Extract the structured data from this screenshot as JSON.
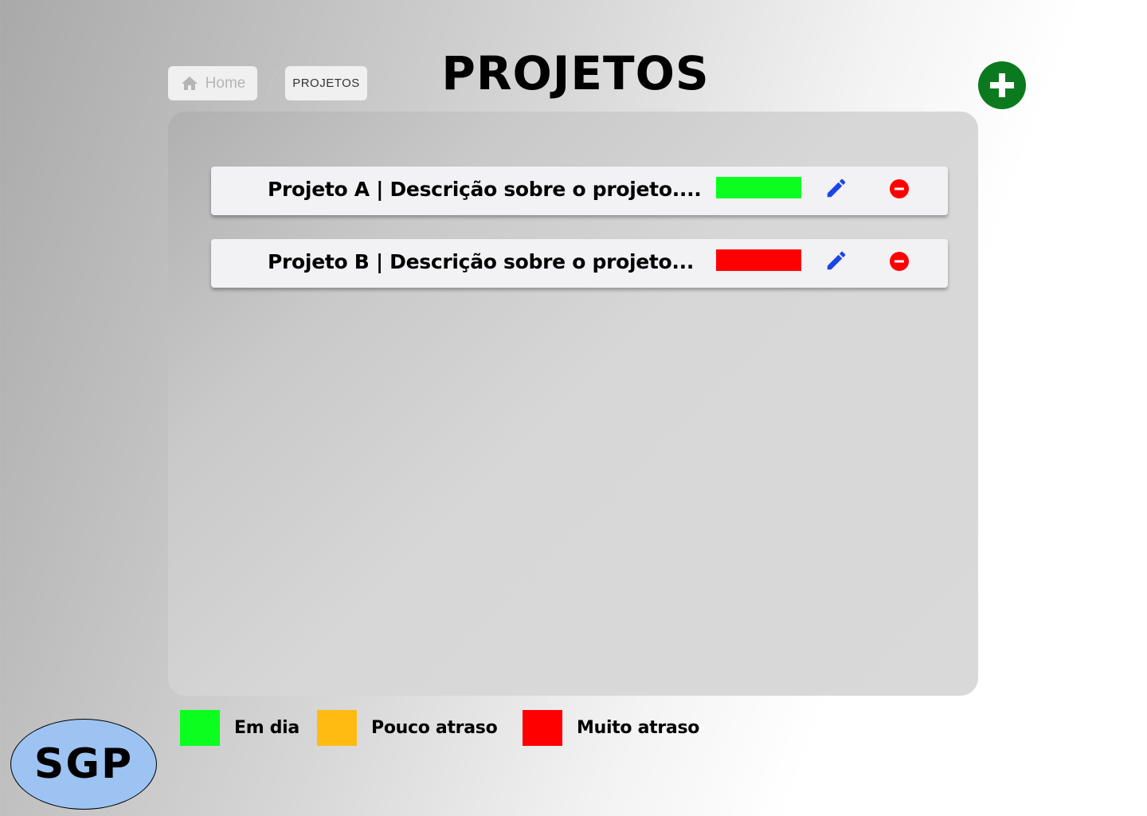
{
  "breadcrumb": {
    "home_label": "Home",
    "current_label": "PROJETOS",
    "home_icon": "home-icon"
  },
  "page": {
    "title": "PROJETOS"
  },
  "toolbar": {
    "add_icon": "plus-icon",
    "add_color": "#0b7a1e"
  },
  "projects": [
    {
      "text": "Projeto A  | Descrição sobre o projeto....",
      "status": "Em dia",
      "status_color": "#0aff1f",
      "edit_icon": "pencil-icon",
      "delete_icon": "minus-circle-icon"
    },
    {
      "text": "Projeto B  | Descrição sobre o projeto...",
      "status": "Muito atraso",
      "status_color": "#ff0000",
      "edit_icon": "pencil-icon",
      "delete_icon": "minus-circle-icon"
    }
  ],
  "legend": [
    {
      "label": "Em dia",
      "color": "#0aff1f"
    },
    {
      "label": "Pouco atraso",
      "color": "#ffbb12"
    },
    {
      "label": "Muito atraso",
      "color": "#ff0000"
    }
  ],
  "logo": {
    "text": "SGP",
    "color": "#9cc3f2"
  }
}
